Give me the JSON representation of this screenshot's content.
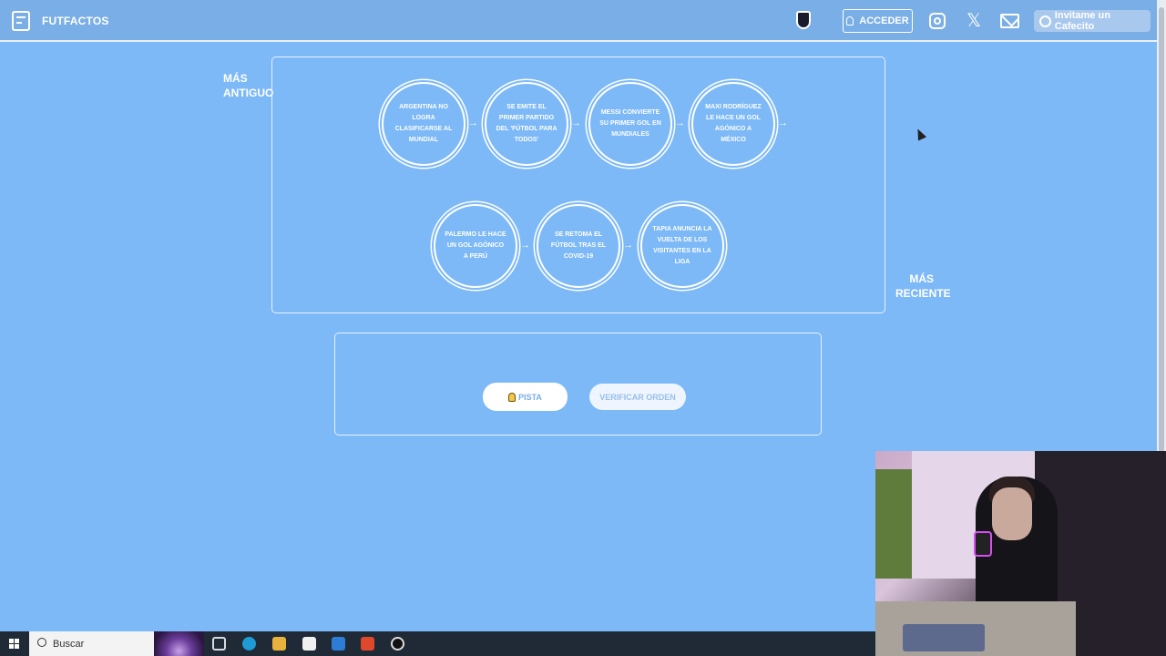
{
  "header": {
    "brand": "FUTFACTOS",
    "login_label": "ACCEDER",
    "cafecito_label": "Invitame un Cafecito"
  },
  "timeline": {
    "label_oldest_line1": "MÁS",
    "label_oldest_line2": "ANTIGUO",
    "label_newest_line1": "MÁS",
    "label_newest_line2": "RECIENTE",
    "events": [
      "Argentina no logra clasificarse al Mundial",
      "Se emite el primer partido del 'Fútbol para Todos'",
      "Messi convierte su primer gol en Mundiales",
      "Maxi Rodríguez le hace un gol agónico a México",
      "Palermo le hace un gol agónico a Perú",
      "Se retoma el fútbol tras el COVID-19",
      "Tapia anuncia la vuelta de los visitantes en la liga"
    ]
  },
  "actions": {
    "hint_label": "PISTA",
    "verify_label": "VERIFICAR ORDEN"
  },
  "taskbar": {
    "search_placeholder": "Buscar"
  },
  "colors": {
    "background": "#7db9f7",
    "header": "#7aaee6",
    "button_text": "#7aaee6"
  },
  "icons": [
    "logo-icon",
    "club-shield-icon",
    "user-icon",
    "instagram-icon",
    "x-icon",
    "mail-icon",
    "coffee-icon",
    "lightbulb-icon",
    "windows-icon",
    "search-icon"
  ]
}
